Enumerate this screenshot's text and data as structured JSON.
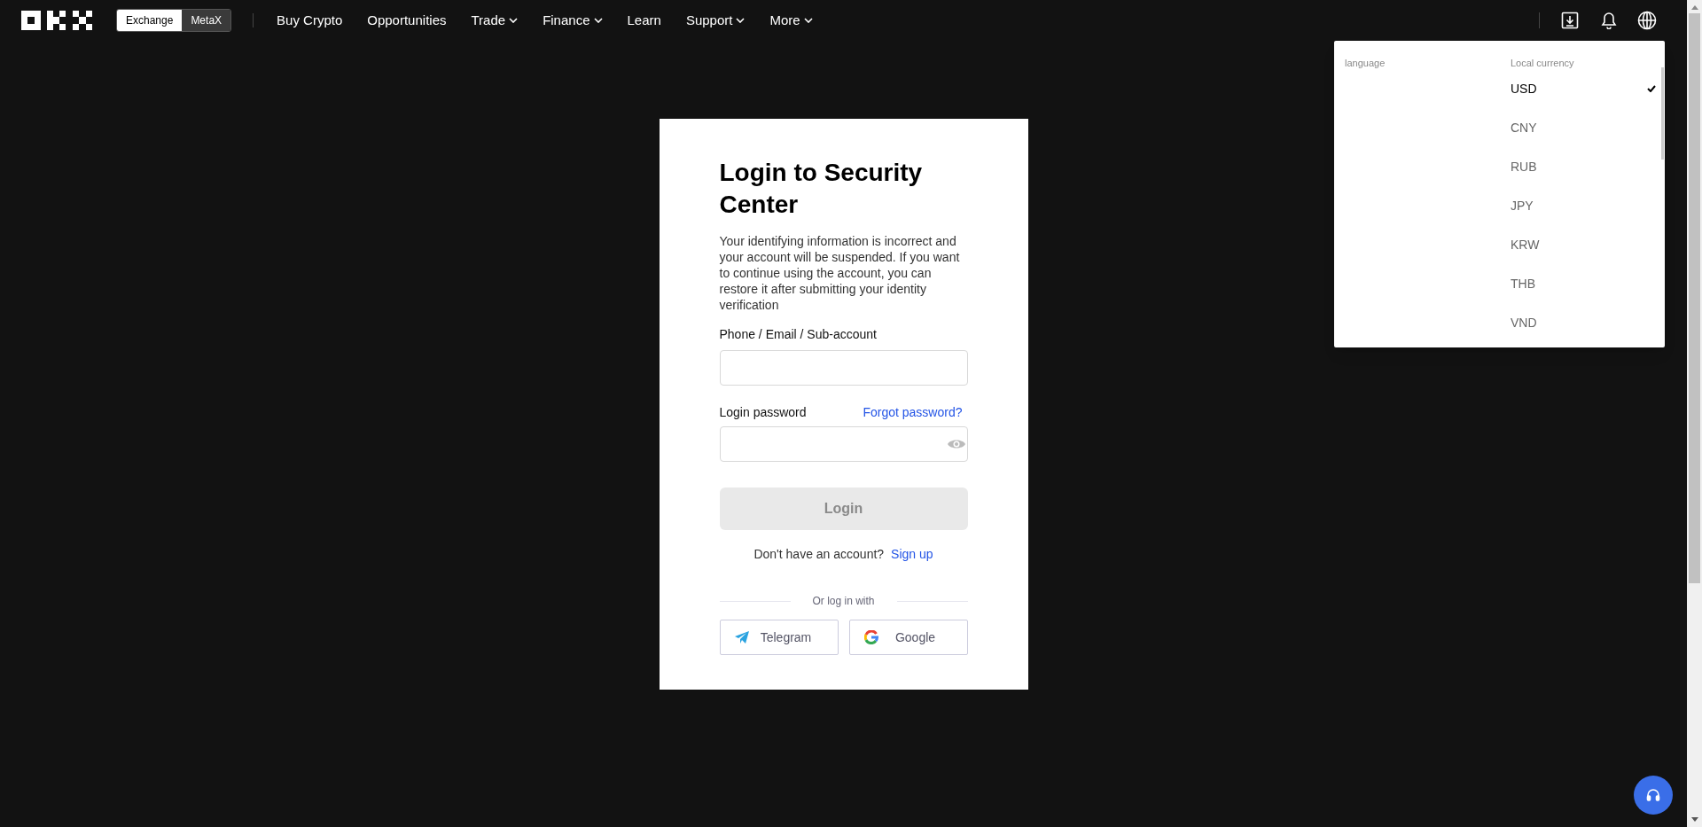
{
  "header": {
    "switch": [
      {
        "label": "Exchange",
        "selected": true
      },
      {
        "label": "MetaX",
        "selected": false
      }
    ],
    "nav": [
      {
        "label": "Buy Crypto",
        "has_menu": false
      },
      {
        "label": "Opportunities",
        "has_menu": false
      },
      {
        "label": "Trade",
        "has_menu": true
      },
      {
        "label": "Finance",
        "has_menu": true
      },
      {
        "label": "Learn",
        "has_menu": false
      },
      {
        "label": "Support",
        "has_menu": true
      },
      {
        "label": "More",
        "has_menu": true
      }
    ]
  },
  "dropdown": {
    "language_heading": "language",
    "currency_heading": "Local currency",
    "currencies": [
      {
        "code": "USD",
        "selected": true
      },
      {
        "code": "CNY",
        "selected": false
      },
      {
        "code": "RUB",
        "selected": false
      },
      {
        "code": "JPY",
        "selected": false
      },
      {
        "code": "KRW",
        "selected": false
      },
      {
        "code": "THB",
        "selected": false
      },
      {
        "code": "VND",
        "selected": false
      }
    ]
  },
  "login": {
    "title": "Login to Security Center",
    "message": "Your identifying information is incorrect and your account will be suspended. If you want to continue using the account, you can restore it after submitting your identity verification",
    "account_label": "Phone / Email / Sub-account",
    "password_label": "Login password",
    "forgot_link": "Forgot password?",
    "login_button": {
      "label": "Login",
      "disabled": true
    },
    "signup_prompt": "Don't have an account?",
    "signup_link": "Sign up",
    "divider": "Or log in with",
    "social": [
      {
        "kind": "telegram",
        "label": "Telegram"
      },
      {
        "kind": "google",
        "label": "Google"
      }
    ]
  }
}
